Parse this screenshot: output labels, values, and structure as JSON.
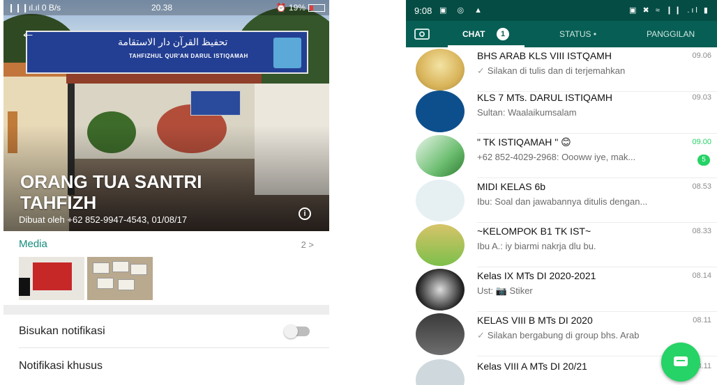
{
  "left_phone": {
    "status_bar": {
      "left": "❙❙❙ıl.ıl 0 B/s",
      "time": "20.38",
      "battery": "⏰ 19%"
    },
    "cover": {
      "banner_arabic": "تحفيظ القرآن دار الاستقامة",
      "banner_latin": "TAHFIZHUL QUR'AN DARUL ISTIQAMAH"
    },
    "group": {
      "title_line1": "ORANG TUA SANTRI",
      "title_line2": "TAHFIZH",
      "created_by": "Dibuat oleh +62 852-9947-4543, 01/08/17"
    },
    "media": {
      "label": "Media",
      "count": "2 >"
    },
    "settings": {
      "mute_label": "Bisukan notifikasi",
      "mute_enabled": false,
      "custom_label": "Notifikasi khusus"
    }
  },
  "right_phone": {
    "status_bar": {
      "time": "9:08",
      "icons_left": "▣ ◎ ▲",
      "icons_right": "▣ ✖ ≈ ❙❙ .ıl ▮"
    },
    "tabs": {
      "chat": "CHAT",
      "chat_badge": "1",
      "status": "STATUS •",
      "calls": "PANGGILAN"
    },
    "chats": [
      {
        "name": "BHS ARAB KLS VIII ISTQAMH",
        "time": "09.06",
        "tick": "✓",
        "message": "Silakan di tulis dan di terjemahkan"
      },
      {
        "name": "KLS 7 MTs. DARUL ISTIQAMH",
        "time": "09.03",
        "message": "Sultan: Waalaikumsalam"
      },
      {
        "name": "\" TK ISTIQAMAH \" 😊",
        "time": "09.00",
        "message": "+62 852-4029-2968: Oooww iye, mak...",
        "unread": "5"
      },
      {
        "name": "MIDI KELAS 6b",
        "time": "08.53",
        "message": "Ibu: Soal dan jawabannya ditulis dengan..."
      },
      {
        "name": "~KELOMPOK B1 TK IST~",
        "time": "08.33",
        "message": "Ibu A.: iy biarmi nakrja dlu bu."
      },
      {
        "name": "Kelas IX MTs DI 2020-2021",
        "time": "08.14",
        "message": "Ust: 📷 Stiker"
      },
      {
        "name": "KELAS VIII B MTs DI 2020",
        "time": "08.11",
        "tick": "✓",
        "message": "Silakan bergabung di group bhs. Arab"
      },
      {
        "name": "Kelas VIII A MTs DI 20/21",
        "time": "08.11",
        "message": ""
      }
    ],
    "colors": {
      "header": "#075e54",
      "status_bar": "#054d44",
      "accent": "#25d366"
    }
  }
}
